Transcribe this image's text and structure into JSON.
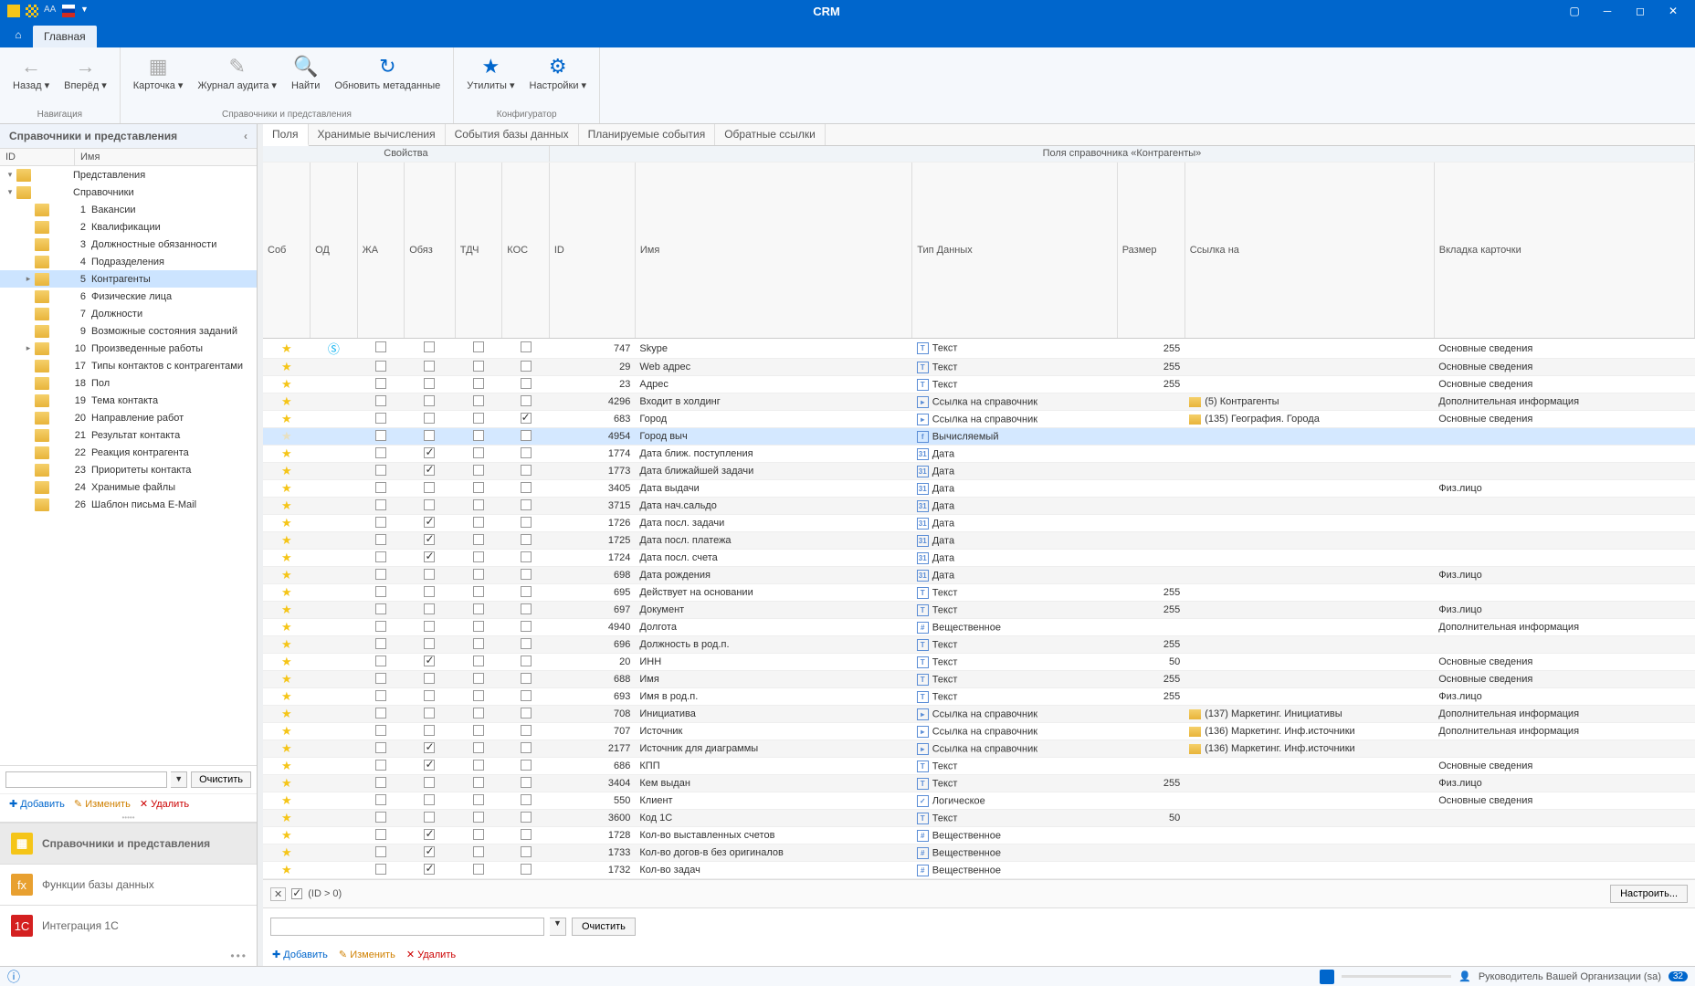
{
  "app_title": "CRM",
  "tab_main": "Главная",
  "ribbon": {
    "groups": [
      {
        "title": "Навигация",
        "buttons": [
          {
            "label": "Назад",
            "icon": "←",
            "dd": true
          },
          {
            "label": "Вперёд",
            "icon": "→",
            "dd": true
          }
        ]
      },
      {
        "title": "Справочники и представления",
        "buttons": [
          {
            "label": "Карточка",
            "icon": "▦",
            "dd": true
          },
          {
            "label": "Журнал аудита",
            "icon": "✎",
            "dd": true
          },
          {
            "label": "Найти",
            "icon": "🔍"
          },
          {
            "label": "Обновить метаданные",
            "icon": "↻"
          }
        ]
      },
      {
        "title": "Конфигуратор",
        "buttons": [
          {
            "label": "Утилиты",
            "icon": "★",
            "dd": true
          },
          {
            "label": "Настройки",
            "icon": "⚙",
            "dd": true
          }
        ]
      }
    ]
  },
  "sidebar": {
    "header": "Справочники и представления",
    "cols": {
      "id": "ID",
      "name": "Имя"
    },
    "tree": [
      {
        "indent": 0,
        "exp": "▾",
        "id": "",
        "name": "Представления"
      },
      {
        "indent": 0,
        "exp": "▾",
        "id": "",
        "name": "Справочники"
      },
      {
        "indent": 2,
        "exp": "",
        "id": "1",
        "name": "Вакансии"
      },
      {
        "indent": 2,
        "id": "2",
        "name": "Квалификации"
      },
      {
        "indent": 2,
        "id": "3",
        "name": "Должностные обязанности"
      },
      {
        "indent": 2,
        "id": "4",
        "name": "Подразделения"
      },
      {
        "indent": 2,
        "exp": "▸",
        "id": "5",
        "name": "Контрагенты",
        "sel": true
      },
      {
        "indent": 2,
        "id": "6",
        "name": "Физические лица"
      },
      {
        "indent": 2,
        "id": "7",
        "name": "Должности"
      },
      {
        "indent": 2,
        "id": "9",
        "name": "Возможные состояния заданий"
      },
      {
        "indent": 2,
        "exp": "▸",
        "id": "10",
        "name": "Произведенные работы"
      },
      {
        "indent": 2,
        "id": "17",
        "name": "Типы контактов с контрагентами"
      },
      {
        "indent": 2,
        "id": "18",
        "name": "Пол"
      },
      {
        "indent": 2,
        "id": "19",
        "name": "Тема контакта"
      },
      {
        "indent": 2,
        "id": "20",
        "name": "Направление работ"
      },
      {
        "indent": 2,
        "id": "21",
        "name": "Результат контакта"
      },
      {
        "indent": 2,
        "id": "22",
        "name": "Реакция контрагента"
      },
      {
        "indent": 2,
        "id": "23",
        "name": "Приоритеты контакта"
      },
      {
        "indent": 2,
        "id": "24",
        "name": "Хранимые файлы"
      },
      {
        "indent": 2,
        "id": "26",
        "name": "Шаблон письма E-Mail"
      }
    ],
    "clear": "Очистить",
    "add": "Добавить",
    "edit": "Изменить",
    "del": "Удалить",
    "panels": [
      {
        "label": "Справочники и представления",
        "icon": "▦",
        "active": true
      },
      {
        "label": "Функции базы данных",
        "icon": "fx"
      },
      {
        "label": "Интеграция 1С",
        "icon": "1С"
      }
    ]
  },
  "content": {
    "tabs": [
      "Поля",
      "Хранимые вычисления",
      "События базы данных",
      "Планируемые события",
      "Обратные ссылки"
    ],
    "active_tab": 0,
    "group_hdr_left": "Свойства",
    "group_hdr_right": "Поля справочника «Контрагенты»",
    "cols": [
      "Соб",
      "ОД",
      "ЖА",
      "Обяз",
      "ТДЧ",
      "КОС",
      "ID",
      "Имя",
      "Тип Данных",
      "Размер",
      "Ссылка на",
      "Вкладка карточки"
    ],
    "rows": [
      {
        "star": 1,
        "od": "S",
        "id": 747,
        "name": "Skype",
        "type": "Текст",
        "ti": "T",
        "size": 255,
        "tab": "Основные сведения"
      },
      {
        "star": 1,
        "id": 29,
        "name": "Web адрес",
        "type": "Текст",
        "ti": "T",
        "size": 255,
        "tab": "Основные сведения"
      },
      {
        "star": 1,
        "id": 23,
        "name": "Адрес",
        "type": "Текст",
        "ti": "T",
        "size": 255,
        "tab": "Основные сведения"
      },
      {
        "star": 1,
        "id": 4296,
        "name": "Входит в холдинг",
        "type": "Ссылка на справочник",
        "ti": "▸",
        "link": "(5) Контрагенты",
        "tab": "Дополнительная информация"
      },
      {
        "star": 1,
        "kos": true,
        "id": 683,
        "name": "Город",
        "type": "Ссылка на справочник",
        "ti": "▸",
        "link": "(135) География. Города",
        "tab": "Основные сведения"
      },
      {
        "star": 0,
        "id": 4954,
        "name": "Город выч",
        "type": "Вычисляемый",
        "ti": "f",
        "sel": true
      },
      {
        "star": 1,
        "obz": true,
        "id": 1774,
        "name": "Дата ближ. поступления",
        "type": "Дата",
        "ti": "31"
      },
      {
        "star": 1,
        "obz": true,
        "id": 1773,
        "name": "Дата ближайшей задачи",
        "type": "Дата",
        "ti": "31"
      },
      {
        "star": 1,
        "id": 3405,
        "name": "Дата выдачи",
        "type": "Дата",
        "ti": "31",
        "tab": "Физ.лицо"
      },
      {
        "star": 1,
        "id": 3715,
        "name": "Дата нач.сальдо",
        "type": "Дата",
        "ti": "31"
      },
      {
        "star": 1,
        "obz": true,
        "id": 1726,
        "name": "Дата посл. задачи",
        "type": "Дата",
        "ti": "31"
      },
      {
        "star": 1,
        "obz": true,
        "id": 1725,
        "name": "Дата посл. платежа",
        "type": "Дата",
        "ti": "31"
      },
      {
        "star": 1,
        "obz": true,
        "id": 1724,
        "name": "Дата посл. счета",
        "type": "Дата",
        "ti": "31"
      },
      {
        "star": 1,
        "id": 698,
        "name": "Дата рождения",
        "type": "Дата",
        "ti": "31",
        "tab": "Физ.лицо"
      },
      {
        "star": 1,
        "id": 695,
        "name": "Действует на основании",
        "type": "Текст",
        "ti": "T",
        "size": 255
      },
      {
        "star": 1,
        "id": 697,
        "name": "Документ",
        "type": "Текст",
        "ti": "T",
        "size": 255,
        "tab": "Физ.лицо"
      },
      {
        "star": 1,
        "id": 4940,
        "name": "Долгота",
        "type": "Вещественное",
        "ti": "#",
        "tab": "Дополнительная информация"
      },
      {
        "star": 1,
        "id": 696,
        "name": "Должность в род.п.",
        "type": "Текст",
        "ti": "T",
        "size": 255
      },
      {
        "star": 1,
        "obz": true,
        "id": 20,
        "name": "ИНН",
        "type": "Текст",
        "ti": "T",
        "size": 50,
        "tab": "Основные сведения"
      },
      {
        "star": 1,
        "id": 688,
        "name": "Имя",
        "type": "Текст",
        "ti": "T",
        "size": 255,
        "tab": "Основные сведения"
      },
      {
        "star": 1,
        "id": 693,
        "name": "Имя в род.п.",
        "type": "Текст",
        "ti": "T",
        "size": 255,
        "tab": "Физ.лицо"
      },
      {
        "star": 1,
        "id": 708,
        "name": "Инициатива",
        "type": "Ссылка на справочник",
        "ti": "▸",
        "link": "(137) Маркетинг. Инициативы",
        "tab": "Дополнительная информация"
      },
      {
        "star": 1,
        "id": 707,
        "name": "Источник",
        "type": "Ссылка на справочник",
        "ti": "▸",
        "link": "(136) Маркетинг. Инф.источники",
        "tab": "Дополнительная информация"
      },
      {
        "star": 1,
        "obz": true,
        "id": 2177,
        "name": "Источник для диаграммы",
        "type": "Ссылка на справочник",
        "ti": "▸",
        "link": "(136) Маркетинг. Инф.источники"
      },
      {
        "star": 1,
        "obz": true,
        "id": 686,
        "name": "КПП",
        "type": "Текст",
        "ti": "T",
        "tab": "Основные сведения"
      },
      {
        "star": 1,
        "id": 3404,
        "name": "Кем выдан",
        "type": "Текст",
        "ti": "T",
        "size": 255,
        "tab": "Физ.лицо"
      },
      {
        "star": 1,
        "id": 550,
        "name": "Клиент",
        "type": "Логическое",
        "ti": "✓",
        "tab": "Основные сведения"
      },
      {
        "star": 1,
        "id": 3600,
        "name": "Код 1С",
        "type": "Текст",
        "ti": "T",
        "size": 50
      },
      {
        "star": 1,
        "obz": true,
        "id": 1728,
        "name": "Кол-во выставленных счетов",
        "type": "Вещественное",
        "ti": "#"
      },
      {
        "star": 1,
        "obz": true,
        "id": 1733,
        "name": "Кол-во догов-в без оригиналов",
        "type": "Вещественное",
        "ti": "#"
      },
      {
        "star": 1,
        "obz": true,
        "id": 1732,
        "name": "Кол-во задач",
        "type": "Вещественное",
        "ti": "#"
      }
    ],
    "filter_expr": "(ID > 0)",
    "filter_cfg": "Настроить...",
    "clear": "Очистить",
    "add": "Добавить",
    "edit": "Изменить",
    "del": "Удалить"
  },
  "status": {
    "user": "Руководитель Вашей Организации (sa)",
    "count": "32"
  }
}
